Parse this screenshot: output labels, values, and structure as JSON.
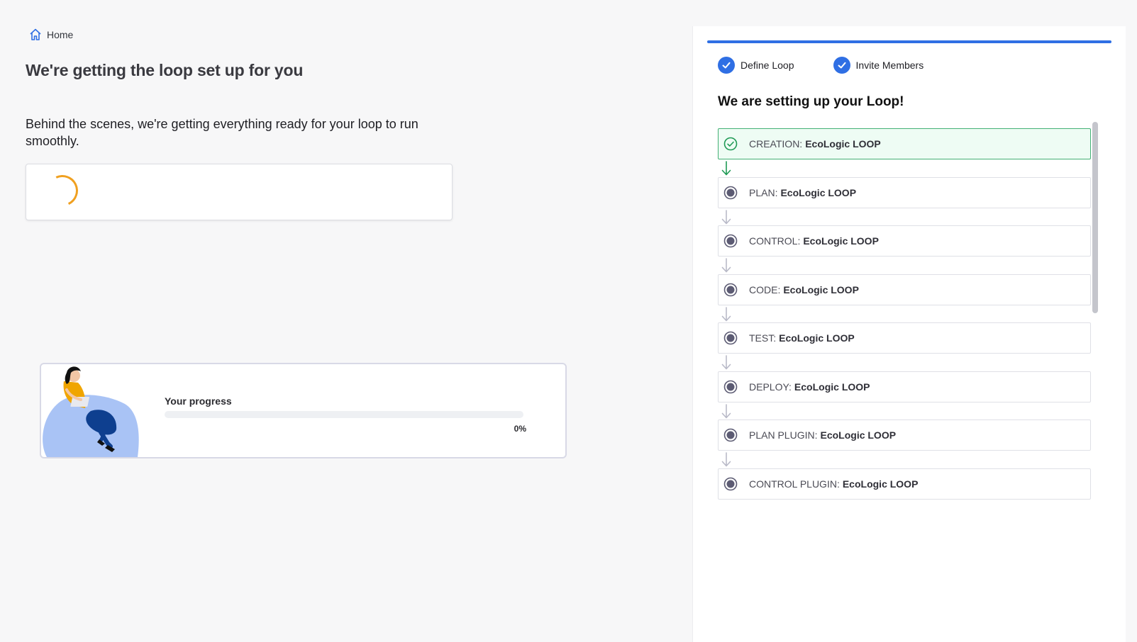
{
  "breadcrumb": {
    "home_label": "Home"
  },
  "main": {
    "title": "We're getting the loop set up for you",
    "description": "Behind the scenes, we're getting everything ready for your loop to run smoothly."
  },
  "progress": {
    "label": "Your progress",
    "value": 0,
    "value_text": "0%"
  },
  "right_panel": {
    "steps": [
      {
        "label": "Define Loop",
        "status": "complete"
      },
      {
        "label": "Invite Members",
        "status": "complete"
      }
    ],
    "title": "We are setting up your Loop!",
    "stages": [
      {
        "prefix": "CREATION:",
        "name": "EcoLogic LOOP",
        "status": "done"
      },
      {
        "prefix": "PLAN:",
        "name": "EcoLogic LOOP",
        "status": "pending"
      },
      {
        "prefix": "CONTROL:",
        "name": "EcoLogic LOOP",
        "status": "pending"
      },
      {
        "prefix": "CODE:",
        "name": "EcoLogic LOOP",
        "status": "pending"
      },
      {
        "prefix": "TEST:",
        "name": "EcoLogic LOOP",
        "status": "pending"
      },
      {
        "prefix": "DEPLOY:",
        "name": "EcoLogic LOOP",
        "status": "pending"
      },
      {
        "prefix": "PLAN PLUGIN:",
        "name": "EcoLogic LOOP",
        "status": "pending"
      },
      {
        "prefix": "CONTROL PLUGIN:",
        "name": "EcoLogic LOOP",
        "status": "pending"
      }
    ]
  },
  "colors": {
    "accent": "#2f6fe4",
    "done_green": "#1f9a55",
    "spinner": "#f0a020",
    "pending_dot": "#5c5b73"
  }
}
